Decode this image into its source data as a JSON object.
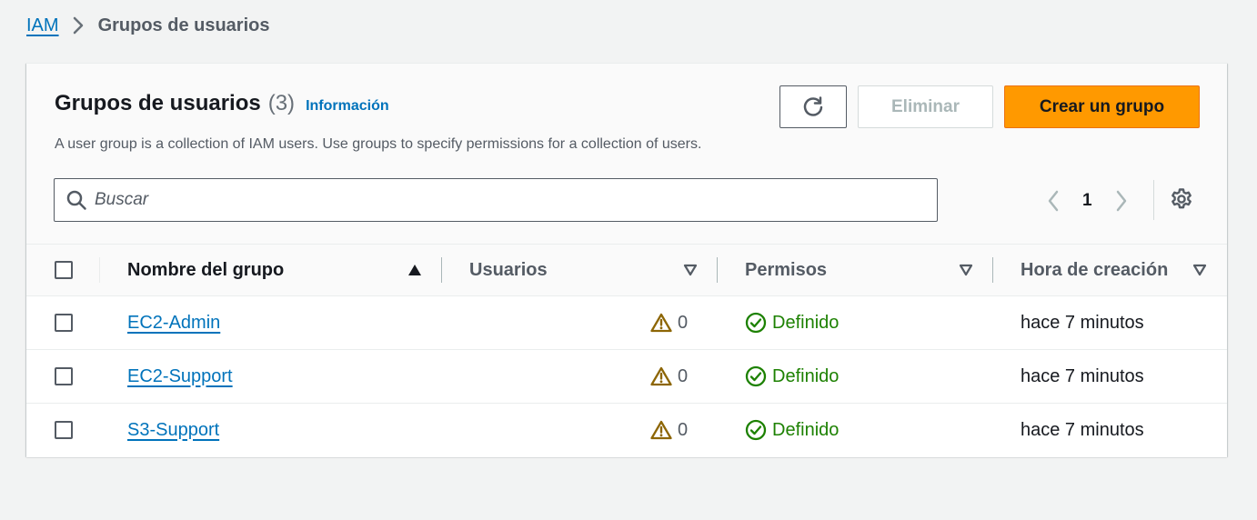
{
  "breadcrumb": {
    "root": "IAM",
    "current": "Grupos de usuarios"
  },
  "header": {
    "title": "Grupos de usuarios",
    "count": "(3)",
    "info_link": "Información",
    "description": "A user group is a collection of IAM users. Use groups to specify permissions for a collection of users.",
    "refresh_icon": "refresh-icon",
    "delete_label": "Eliminar",
    "create_label": "Crear un grupo"
  },
  "search": {
    "placeholder": "Buscar",
    "value": ""
  },
  "pagination": {
    "current_page": "1"
  },
  "table": {
    "columns": [
      {
        "label": "Nombre del grupo",
        "sort": "ascending"
      },
      {
        "label": "Usuarios",
        "sort": "none"
      },
      {
        "label": "Permisos",
        "sort": "none"
      },
      {
        "label": "Hora de creación",
        "sort": "none"
      }
    ],
    "rows": [
      {
        "name": "EC2-Admin",
        "users": "0",
        "permissions": "Definido",
        "created": "hace 7 minutos"
      },
      {
        "name": "EC2-Support",
        "users": "0",
        "permissions": "Definido",
        "created": "hace 7 minutos"
      },
      {
        "name": "S3-Support",
        "users": "0",
        "permissions": "Definido",
        "created": "hace 7 minutos"
      }
    ]
  },
  "colors": {
    "link": "#0073bb",
    "primary_button": "#ff9900",
    "success": "#1d8102",
    "warning": "#8d6605",
    "background": "#f2f3f3"
  }
}
